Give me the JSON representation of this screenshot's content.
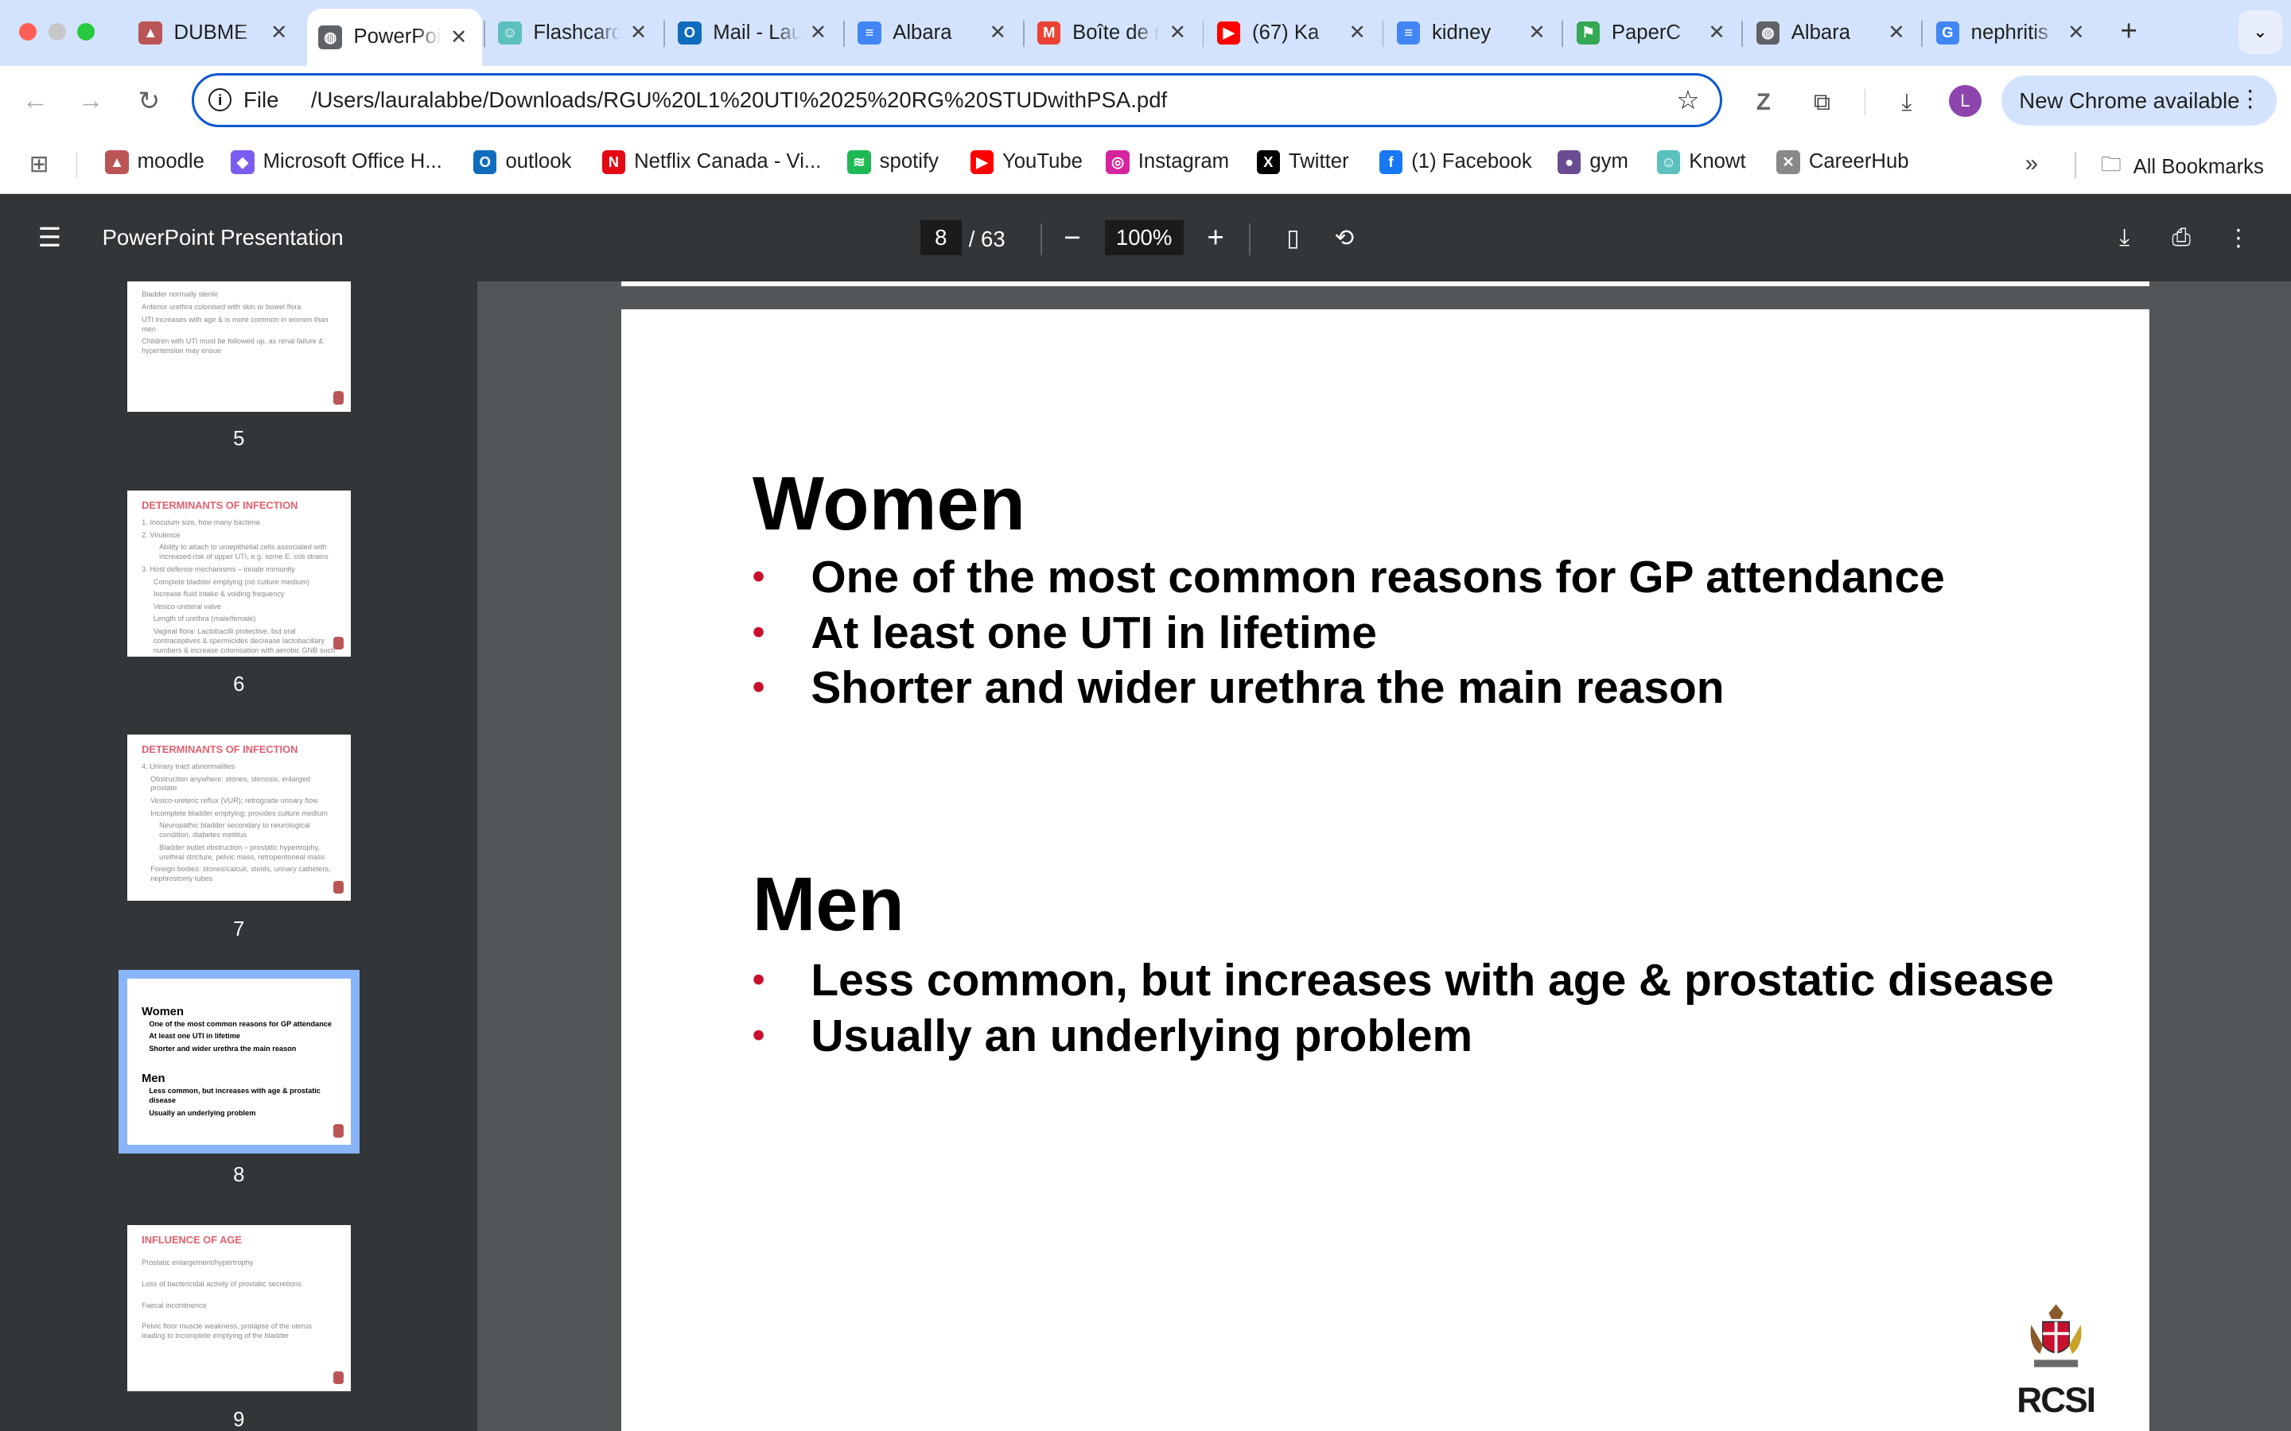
{
  "tabs": [
    {
      "title": "DUBME",
      "icon": "rcsi-icon",
      "color": "#b55"
    },
    {
      "title": "PowerPoint Presentation",
      "icon": "globe-icon",
      "color": "#5f6368"
    },
    {
      "title": "Flashcards",
      "icon": "flashcard-icon",
      "color": "#5bc0be"
    },
    {
      "title": "Mail - Laura",
      "icon": "outlook-icon",
      "color": "#0f6cbd"
    },
    {
      "title": "Albara",
      "icon": "docs-icon",
      "color": "#4285f4"
    },
    {
      "title": "Boîte de réception",
      "icon": "gmail-icon",
      "color": "#ea4335"
    },
    {
      "title": "(67) Ka",
      "icon": "youtube-icon",
      "color": "#ff0000"
    },
    {
      "title": "kidney",
      "icon": "docs-icon",
      "color": "#4285f4"
    },
    {
      "title": "PaperC",
      "icon": "paper-icon",
      "color": "#34a853"
    },
    {
      "title": "Albara",
      "icon": "globe-icon",
      "color": "#5f6368"
    },
    {
      "title": "nephritis",
      "icon": "google-icon",
      "color": "#4285f4"
    }
  ],
  "address": {
    "scheme_label": "File",
    "url": "/Users/lauralabbe/Downloads/RGU%20L1%20UTI%2025%20RG%20STUDwithPSA.pdf"
  },
  "profile_initial": "L",
  "new_chrome_label": "New Chrome available",
  "bookmarks": [
    {
      "label": "moodle",
      "icon": "moodle-icon",
      "color": "#b55"
    },
    {
      "label": "Microsoft Office H...",
      "icon": "office-icon",
      "color": "#7b5cf0"
    },
    {
      "label": "outlook",
      "icon": "outlook-icon",
      "color": "#0f6cbd"
    },
    {
      "label": "Netflix Canada - Vi...",
      "icon": "netflix-icon",
      "color": "#e50914"
    },
    {
      "label": "spotify",
      "icon": "spotify-icon",
      "color": "#1db954"
    },
    {
      "label": "YouTube",
      "icon": "youtube-icon",
      "color": "#ff0000"
    },
    {
      "label": "Instagram",
      "icon": "instagram-icon",
      "color": "#d6249f"
    },
    {
      "label": "Twitter",
      "icon": "x-icon",
      "color": "#000000"
    },
    {
      "label": "(1) Facebook",
      "icon": "facebook-icon",
      "color": "#1877f2"
    },
    {
      "label": "gym",
      "icon": "gym-icon",
      "color": "#6a4c93"
    },
    {
      "label": "Knowt",
      "icon": "knowt-icon",
      "color": "#5bc0be"
    },
    {
      "label": "CareerHub",
      "icon": "careerhub-icon",
      "color": "#888888"
    }
  ],
  "all_bookmarks_label": "All Bookmarks",
  "pdf": {
    "title": "PowerPoint Presentation",
    "current_page": "8",
    "total_pages": "/ 63",
    "zoom": "100%"
  },
  "thumbnails": [
    {
      "num": "5",
      "heading": "",
      "lines": [
        "Bladder normally sterile",
        "Anterior urethra colonised with skin or bowel flora",
        "UTI increases with age & is more common in women than men",
        "Children with UTI must be followed up, as renal failure & hypertension may ensue"
      ]
    },
    {
      "num": "6",
      "heading": "DETERMINANTS OF INFECTION",
      "lines": [
        "1. Inoculum size, how many bacteria",
        "2. Virulence",
        "Ability to attach to uroepithelial cells associated with increased risk of upper UTI, e.g. some E. coli strains",
        "3. Host defence mechanisms – innate immunity",
        "Complete bladder emptying (no culture medium)",
        "Increase fluid intake & voiding frequency",
        "Vesico-ureteral valve",
        "Length of urethra (male/female)",
        "Vaginal flora: Lactobacilli protective, but oral contraceptives & spermicides decrease lactobacillary numbers & increase colonisation with aerobic GNB such as Escherichia coli"
      ]
    },
    {
      "num": "7",
      "heading": "DETERMINANTS OF INFECTION",
      "lines": [
        "4. Urinary tract abnormalities",
        "Obstruction anywhere: stones, stenosis, enlarged prostate",
        "Vesico-ureteric reflux (VUR); retrograde urinary flow",
        "Incomplete bladder emptying; provides culture medium",
        "Neuropathic bladder secondary to neurological condition, diabetes mellitus",
        "Bladder outlet obstruction – prostatic hypertrophy, urethral stricture, pelvic mass, retroperitoneal mass",
        "Foreign bodies: stones/calculi, stents, urinary catheters, nephrostomy tubes"
      ]
    },
    {
      "num": "8",
      "heading": "",
      "lines": [
        "Women",
        "One of the most common reasons for GP attendance",
        "At least one UTI in lifetime",
        "Shorter and wider urethra the main reason",
        "Men",
        "Less common, but increases with age & prostatic disease",
        "Usually an underlying problem"
      ]
    },
    {
      "num": "9",
      "heading": "INFLUENCE OF AGE",
      "lines": [
        "Prostatic enlargement/hypertrophy",
        "Loss of bactericidal activity of prostatic secretions",
        "Faecal incontinence",
        "Pelvic floor muscle weakness, prolapse of the uterus leading to incomplete emptying of the bladder"
      ]
    }
  ],
  "slide": {
    "women_heading": "Women",
    "women_points": [
      "One of the most common reasons for GP attendance",
      "At least one UTI in lifetime",
      "Shorter and wider urethra the main reason"
    ],
    "men_heading": "Men",
    "men_points": [
      "Less common, but increases with age & prostatic disease",
      "Usually an underlying problem"
    ],
    "logo_text": "RCSI"
  }
}
